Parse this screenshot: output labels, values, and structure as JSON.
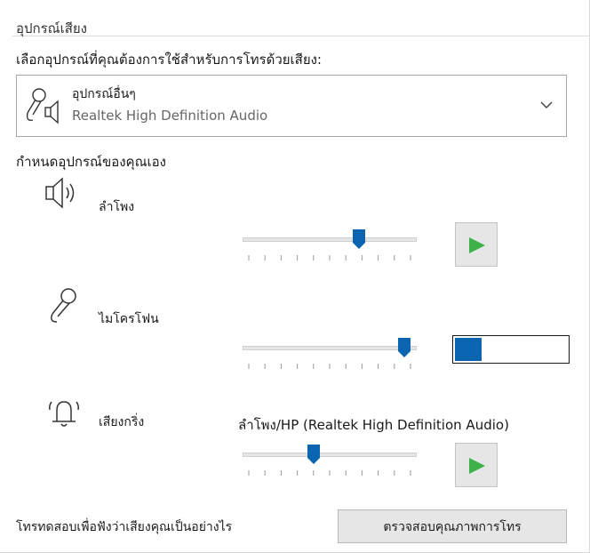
{
  "group": {
    "title": "อุปกรณ์เสียง",
    "prompt": "เลือกอุปกรณ์ที่คุณต้องการใช้สำหรับการโทรด้วยเสียง:"
  },
  "device_select": {
    "name": "อุปกรณ์อื่นๆ",
    "description": "Realtek High Definition Audio",
    "icon": "microphone-speaker-icon"
  },
  "custom": {
    "heading": "กำหนดอุปกรณ์ของคุณเอง"
  },
  "speaker": {
    "label": "ลำโพง",
    "icon": "speaker-icon",
    "volume": 0.68
  },
  "microphone": {
    "label": "ไมโครโฟน",
    "icon": "microphone-icon",
    "volume": 0.96,
    "level": 0.24
  },
  "ringer": {
    "label": "เสียงกริ่ง",
    "icon": "bell-icon",
    "device": "ลำโพง/HP (Realtek High Definition Audio)",
    "volume": 0.4
  },
  "footer": {
    "text": "โทรทดสอบเพื่อฟังว่าเสียงคุณเป็นอย่างไร",
    "button": "ตรวจสอบคุณภาพการโทร"
  },
  "colors": {
    "accent": "#0a64b0",
    "play": "#3db24a"
  }
}
